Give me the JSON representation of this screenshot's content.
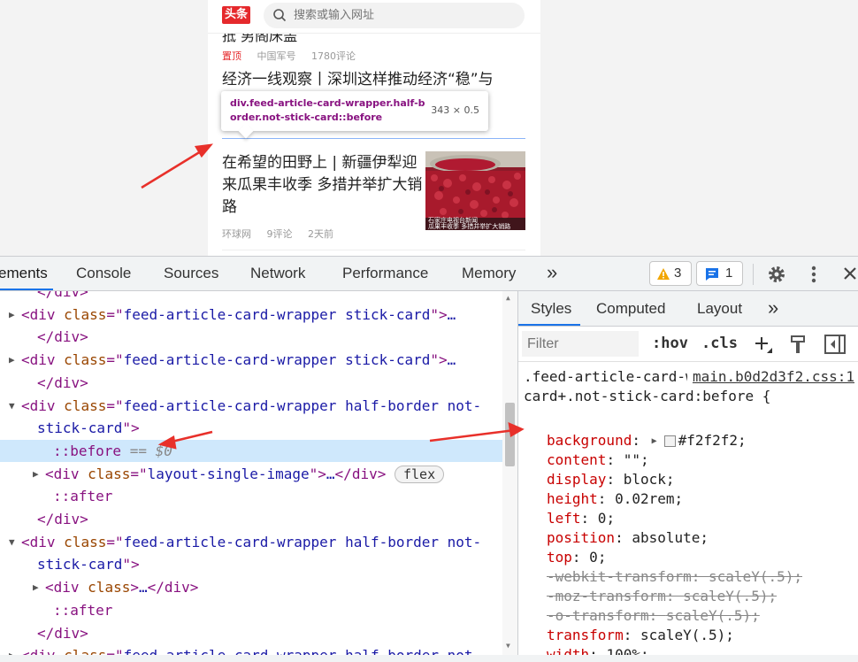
{
  "page": {
    "logo_text": "头条",
    "search_placeholder": "搜索或输入网址",
    "cut_title": "抵 男阁床盖",
    "meta1": {
      "top": "置顶",
      "source": "中国军号",
      "comments": "1780评论"
    },
    "article1_title": "经济一线观察丨深圳这样推动经济“稳”与",
    "tooltip": {
      "selector_part1": "div",
      "selector_part2": ".feed-article-card-wrapper.half-b",
      "selector_line2": "order.not-stick-card::before",
      "size": "343 × 0.5"
    },
    "article2_title": "在希望的田野上 | 新疆伊犁迎来瓜果丰收季 多措并举扩大销路",
    "article2_meta": {
      "source": "环球网",
      "comments": "9评论",
      "time": "2天前"
    },
    "thumb_caption": "瓜果丰收季 多措并举扩大销路",
    "thumb_caption_small": "石家庄电视台新闻"
  },
  "devtools": {
    "tabs": [
      "ements",
      "Console",
      "Sources",
      "Network",
      "Performance",
      "Memory"
    ],
    "more_tabs": "»",
    "warnings_count": "3",
    "messages_count": "1",
    "elements": {
      "rows": [
        {
          "indent": 1,
          "arrow": "",
          "parts": [
            [
              "tg",
              "</div>"
            ]
          ]
        },
        {
          "indent": 0,
          "arrow": "▶",
          "parts": [
            [
              "tg",
              "<div "
            ],
            [
              "an",
              "class"
            ],
            [
              "tg",
              "=\""
            ],
            [
              "av",
              "feed-article-card-wrapper stick-card"
            ],
            [
              "tg",
              "\">"
            ],
            [
              "pt",
              "…"
            ]
          ]
        },
        {
          "indent": 1,
          "arrow": "",
          "parts": [
            [
              "tg",
              "</div>"
            ]
          ]
        },
        {
          "indent": 0,
          "arrow": "▶",
          "parts": [
            [
              "tg",
              "<div "
            ],
            [
              "an",
              "class"
            ],
            [
              "tg",
              "=\""
            ],
            [
              "av",
              "feed-article-card-wrapper stick-card"
            ],
            [
              "tg",
              "\">"
            ],
            [
              "pt",
              "…"
            ]
          ]
        },
        {
          "indent": 1,
          "arrow": "",
          "parts": [
            [
              "tg",
              "</div>"
            ]
          ]
        },
        {
          "indent": 0,
          "arrow": "▼",
          "parts": [
            [
              "tg",
              "<div "
            ],
            [
              "an",
              "class"
            ],
            [
              "tg",
              "=\""
            ],
            [
              "av",
              "feed-article-card-wrapper half-border not-"
            ]
          ]
        },
        {
          "indent": 1,
          "arrow": "",
          "parts": [
            [
              "av",
              "stick-card"
            ],
            [
              "tg",
              "\">"
            ]
          ]
        },
        {
          "indent": 2,
          "arrow": "",
          "sel": true,
          "parts": [
            [
              "pseudo",
              "::before"
            ],
            [
              "dollar",
              " == $0"
            ]
          ]
        },
        {
          "indent": 1.5,
          "arrow": "▶",
          "parts": [
            [
              "tg",
              "<div "
            ],
            [
              "an",
              "class"
            ],
            [
              "tg",
              "=\""
            ],
            [
              "av",
              "layout-single-image"
            ],
            [
              "tg",
              "\">"
            ],
            [
              "pt",
              "…"
            ],
            [
              "tg",
              "</div>"
            ]
          ],
          "flex": "flex"
        },
        {
          "indent": 2,
          "arrow": "",
          "parts": [
            [
              "pseudo",
              "::after"
            ]
          ]
        },
        {
          "indent": 1,
          "arrow": "",
          "parts": [
            [
              "tg",
              "</div>"
            ]
          ]
        },
        {
          "indent": 0,
          "arrow": "▼",
          "parts": [
            [
              "tg",
              "<div "
            ],
            [
              "an",
              "class"
            ],
            [
              "tg",
              "=\""
            ],
            [
              "av",
              "feed-article-card-wrapper half-border not-"
            ]
          ]
        },
        {
          "indent": 1,
          "arrow": "",
          "parts": [
            [
              "av",
              "stick-card"
            ],
            [
              "tg",
              "\">"
            ]
          ]
        },
        {
          "indent": 1.5,
          "arrow": "▶",
          "parts": [
            [
              "tg",
              "<div "
            ],
            [
              "an",
              "class"
            ],
            [
              "tg",
              ">"
            ],
            [
              "pt",
              "…"
            ],
            [
              "tg",
              "</div>"
            ]
          ]
        },
        {
          "indent": 2,
          "arrow": "",
          "parts": [
            [
              "pseudo",
              "::after"
            ]
          ]
        },
        {
          "indent": 1,
          "arrow": "",
          "parts": [
            [
              "tg",
              "</div>"
            ]
          ]
        },
        {
          "indent": 0,
          "arrow": "▶",
          "parts": [
            [
              "tg",
              "<div "
            ],
            [
              "an",
              "class"
            ],
            [
              "tg",
              "=\""
            ],
            [
              "av",
              "feed-article-card-wrapper half-border not-"
            ]
          ]
        }
      ]
    },
    "styles": {
      "tabs": [
        "Styles",
        "Computed",
        "Layout"
      ],
      "more": "»",
      "filter_placeholder": "Filter",
      "hov": ":hov",
      "cls": ".cls",
      "selector": ".feed-article-card-wrapper.stick-card+.not-stick-card:before {",
      "source": "main.b0d2d3f2.css:1",
      "declarations": [
        {
          "name": "background",
          "value": "#f2f2f2",
          "swatch": true
        },
        {
          "name": "content",
          "value": "\"\""
        },
        {
          "name": "display",
          "value": "block"
        },
        {
          "name": "height",
          "value": "0.02rem"
        },
        {
          "name": "left",
          "value": "0"
        },
        {
          "name": "position",
          "value": "absolute"
        },
        {
          "name": "top",
          "value": "0"
        },
        {
          "name": "-webkit-transform",
          "value": "scaleY(.5)",
          "strike": true
        },
        {
          "name": "-moz-transform",
          "value": "scaleY(.5)",
          "strike": true
        },
        {
          "name": "-o-transform",
          "value": "scaleY(.5)",
          "strike": true
        },
        {
          "name": "transform",
          "value": "scaleY(.5)"
        },
        {
          "name": "width",
          "value": "100%"
        }
      ]
    }
  },
  "colors": {
    "accent": "#1a73e8",
    "logo_red": "#e5292c",
    "selection": "#cfe8fc",
    "annotation_arrow": "#e8302a"
  }
}
